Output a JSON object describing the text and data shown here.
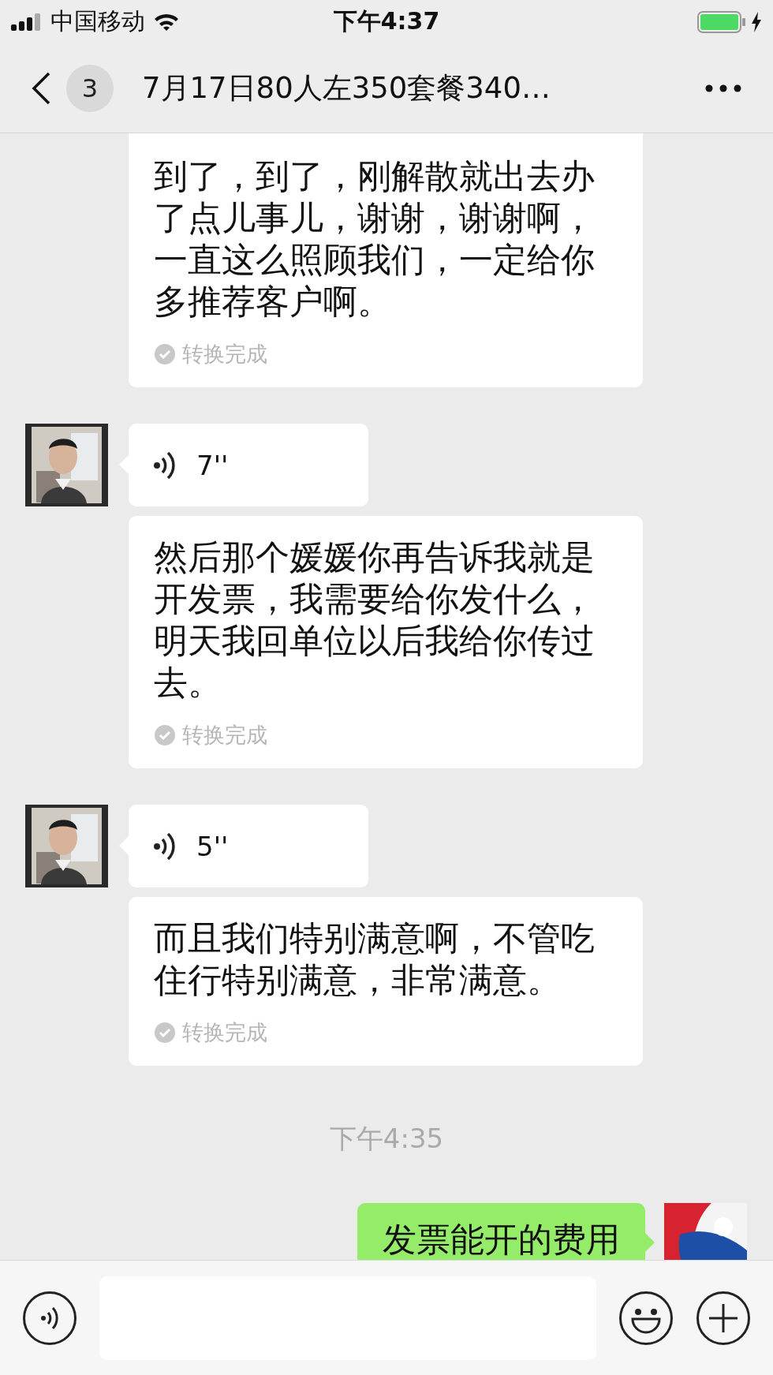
{
  "status_bar": {
    "carrier": "中国移动",
    "time": "下午4:37"
  },
  "header": {
    "unread_count": "3",
    "title": "7月17日80人左350套餐340…"
  },
  "messages": [
    {
      "kind": "transcript",
      "text": "到了，到了，刚解散就出去办了点儿事儿，谢谢，谢谢啊，一直这么照顾我们，一定给你多推荐客户啊。",
      "status": "转换完成",
      "cut_top": true
    },
    {
      "kind": "voice",
      "duration": "7''"
    },
    {
      "kind": "transcript",
      "text": "然后那个媛媛你再告诉我就是开发票，我需要给你发什么，明天我回单位以后我给你传过去。",
      "status": "转换完成",
      "cut_top": false
    },
    {
      "kind": "voice",
      "duration": "5''"
    },
    {
      "kind": "transcript",
      "text": "而且我们特别满意啊，不管吃住行特别满意，非常满意。",
      "status": "转换完成",
      "cut_top": false
    },
    {
      "kind": "time",
      "text": "下午4:35"
    },
    {
      "kind": "text",
      "outgoing": true,
      "text": "发票能开的费用"
    }
  ]
}
